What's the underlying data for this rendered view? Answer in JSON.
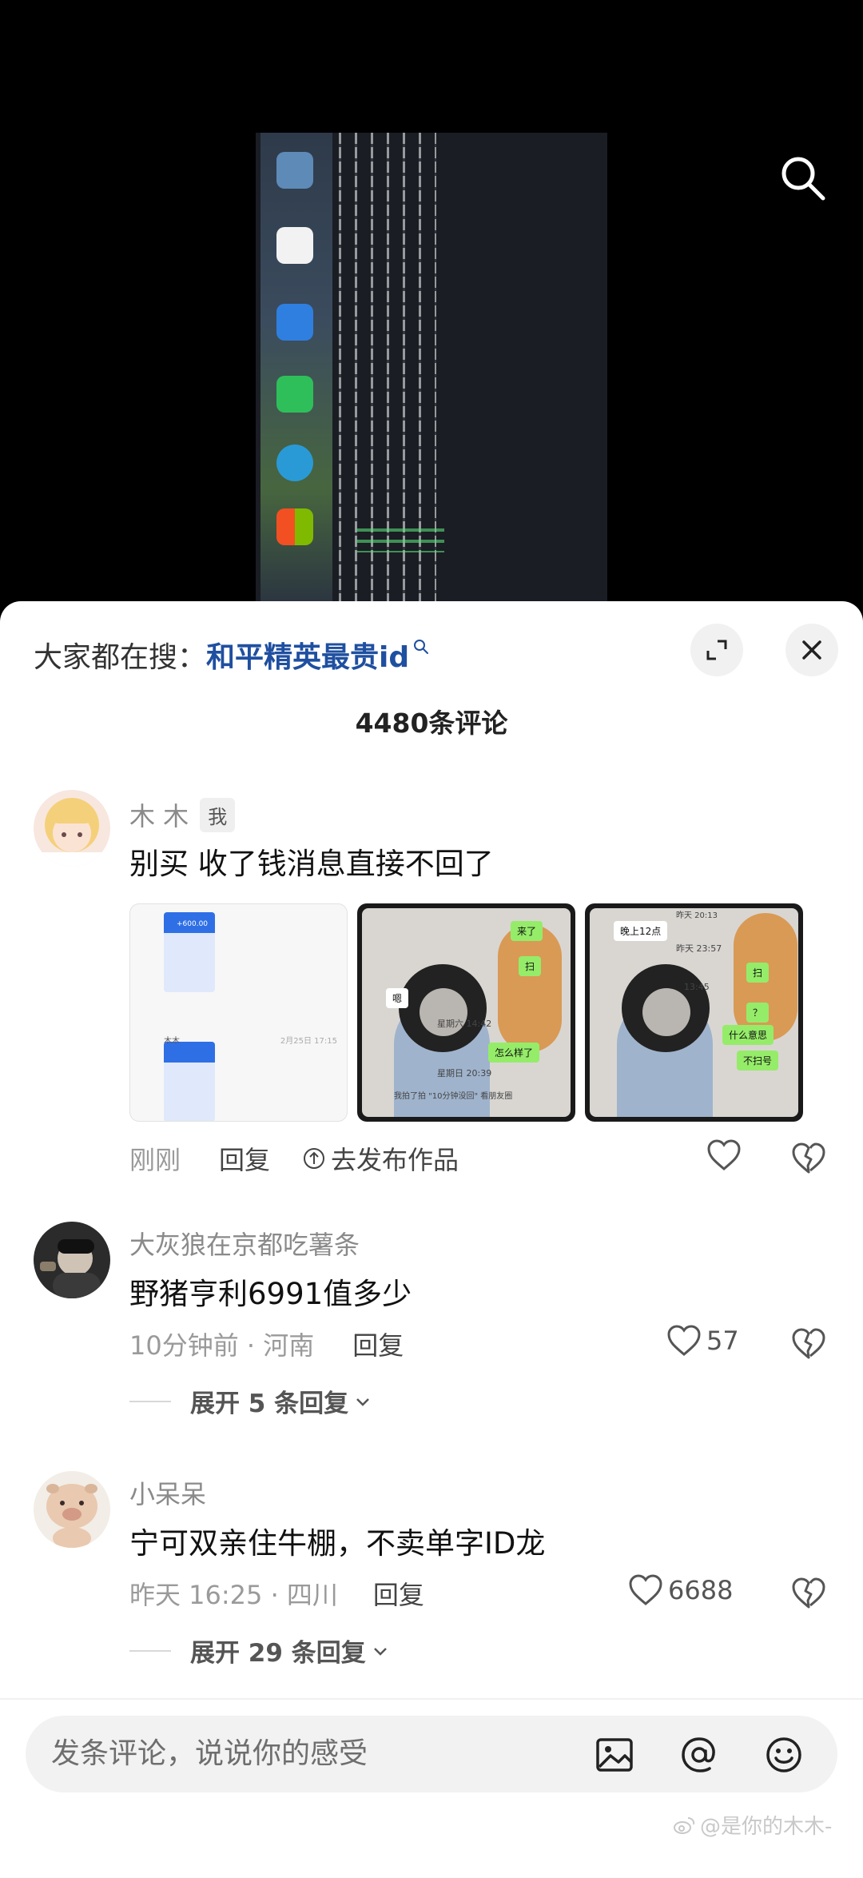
{
  "header": {
    "hot_search_prefix": "大家都在搜：",
    "hot_search_term": "和平精英最贵id"
  },
  "comment_count": "4480条评论",
  "comments": [
    {
      "author": "木 木",
      "badge": "我",
      "text": "别买 收了钱消息直接不回了",
      "time": "刚刚",
      "reply_label": "回复",
      "publish_label": "去发布作品",
      "images": {
        "img1": {
          "name": "木木",
          "date": "2月25日 17:15",
          "amount": "+600.00"
        },
        "img2": {
          "bubbles": [
            "来了",
            "扫",
            "怎么样了"
          ],
          "gray_bubble": "嗯",
          "times": [
            "星期六 14:42",
            "星期日 20:39"
          ],
          "caption": "我拍了拍 \"10分钟没回\" 看朋友圈"
        },
        "img3": {
          "top_time": "昨天 20:13",
          "bubbles": [
            "扫",
            "？",
            "什么意思",
            "不扫号"
          ],
          "white_bubble": "晚上12点",
          "times": [
            "昨天 23:57",
            "13:45"
          ]
        }
      }
    },
    {
      "author": "大灰狼在京都吃薯条",
      "text": "野猪亨利6991值多少",
      "time": "10分钟前 · 河南",
      "reply_label": "回复",
      "likes": "57",
      "expand_label": "展开 5 条回复"
    },
    {
      "author": "小呆呆",
      "text": "宁可双亲住牛棚，不卖单字ID龙",
      "time": "昨天 16:25 · 四川",
      "reply_label": "回复",
      "likes": "6688",
      "expand_label": "展开 29 条回复"
    }
  ],
  "input": {
    "placeholder": "发条评论，说说你的感受"
  },
  "watermark": "@是你的木木-",
  "icons": [
    "search-icon",
    "expand-icon",
    "close-icon",
    "heart-icon",
    "dislike-icon",
    "image-icon",
    "at-icon",
    "emoji-icon",
    "publish-arrow-icon",
    "chevron-down-icon",
    "weibo-icon"
  ],
  "colors": {
    "hot_term": "#1f4fa0",
    "sheet_bg": "#ffffff",
    "input_bg": "#f2f2f2",
    "chat_green": "#95ec69"
  }
}
